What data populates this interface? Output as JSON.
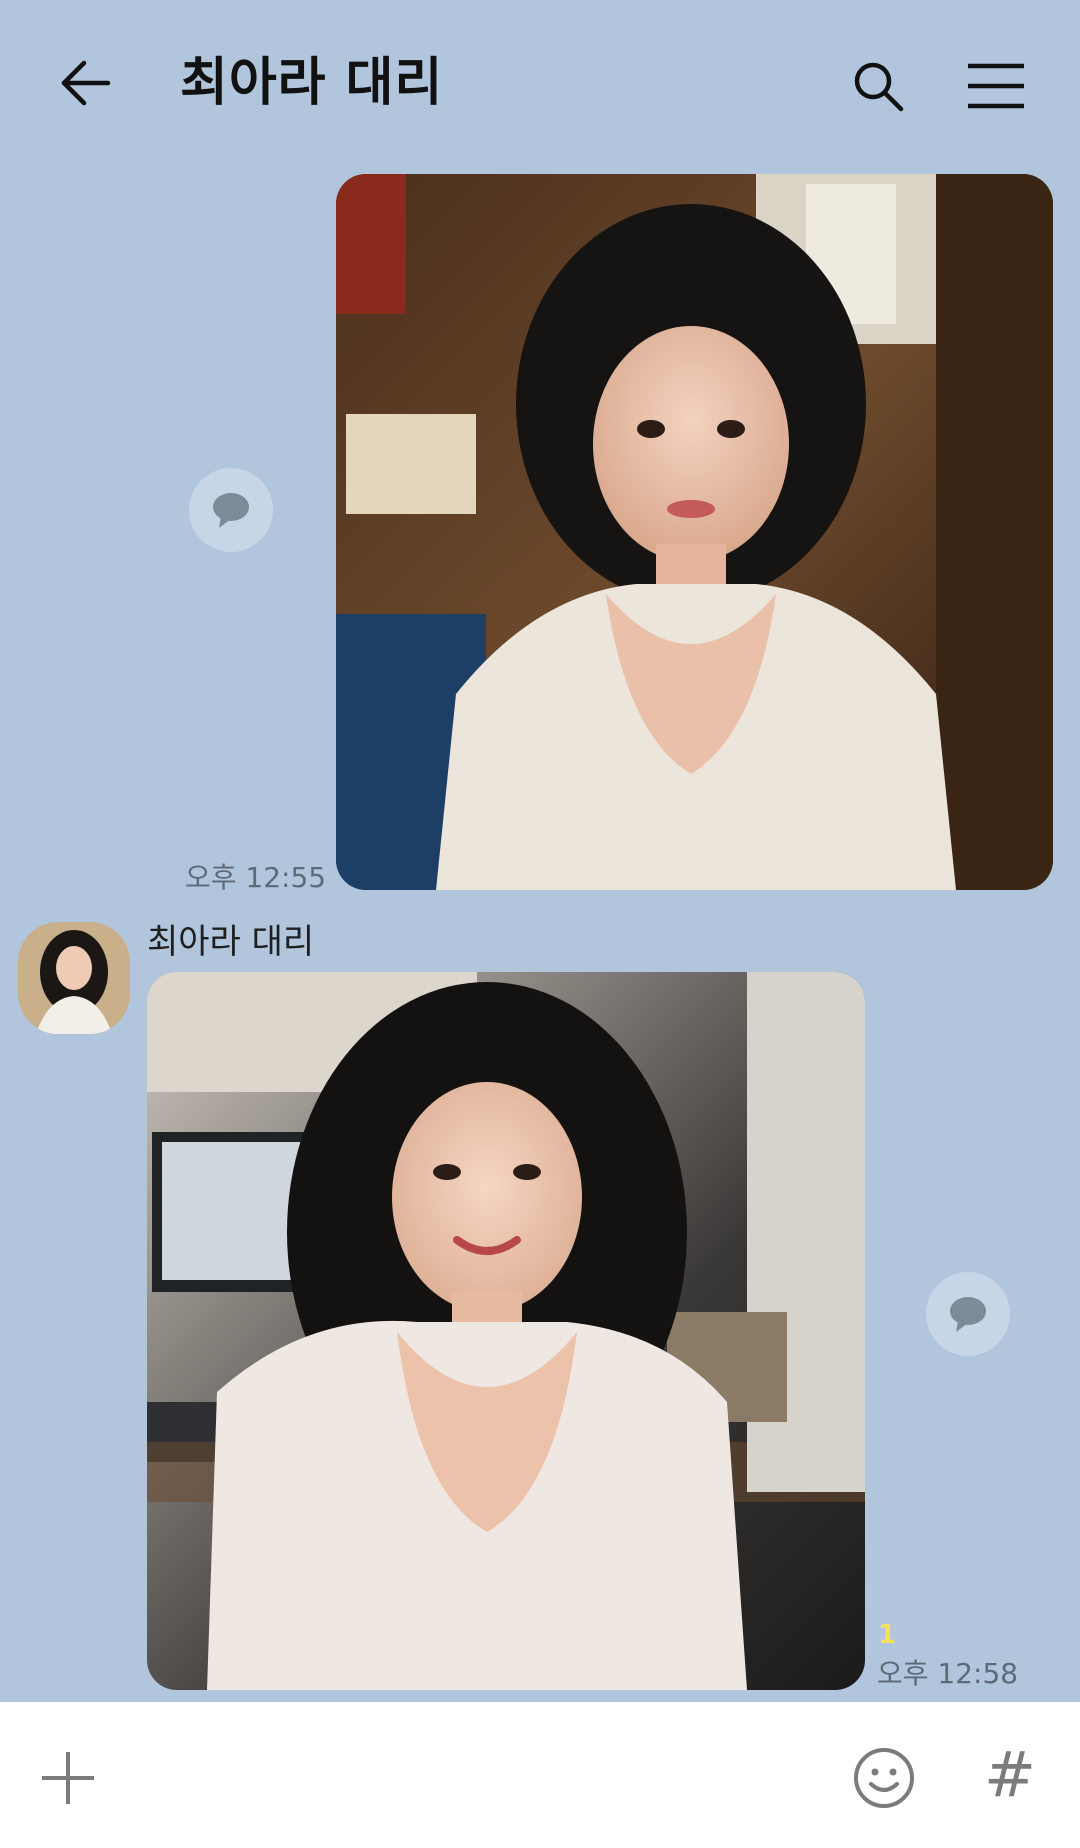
{
  "header": {
    "title": "최아라 대리",
    "back_icon": "arrow-left-icon",
    "search_icon": "search-icon",
    "menu_icon": "hamburger-menu-icon"
  },
  "messages": [
    {
      "direction": "sent",
      "type": "photo",
      "time": "오후 12:55"
    },
    {
      "direction": "received",
      "type": "photo",
      "sender": "최아라 대리",
      "unread_count": "1",
      "time": "오후 12:58"
    }
  ],
  "input_bar": {
    "plus_icon": "plus-icon",
    "emoji_icon": "emoji-icon",
    "hash_label": "#"
  },
  "colors": {
    "chat_background": "#b1c6dd",
    "unread_badge": "#f6e05a",
    "time_text": "#5e6a78"
  }
}
